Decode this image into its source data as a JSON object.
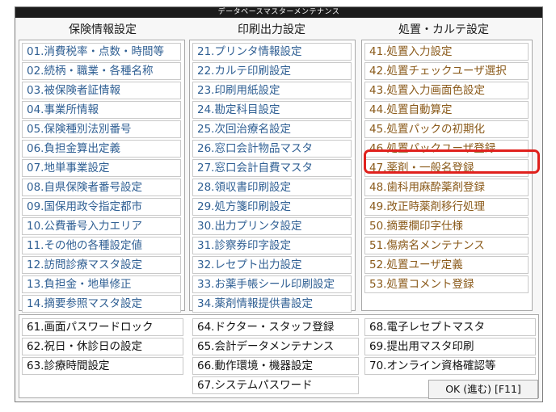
{
  "window": {
    "title": "データベースマスターメンテナンス"
  },
  "columns": [
    {
      "header": "保険情報設定",
      "items": [
        "01.消費税率・点数・時間等",
        "02.続柄・職業・各種名称",
        "03.被保険者証情報",
        "04.事業所情報",
        "05.保険種別法別番号",
        "06.負担金算出定義",
        "07.地単事業設定",
        "08.自県保険者番号設定",
        "09.国保用政令指定都市",
        "10.公費番号入力エリア",
        "11.その他の各種設定値",
        "12.訪問診療マスタ設定",
        "13.負担金・地単修正",
        "14.摘要参照マスタ設定"
      ]
    },
    {
      "header": "印刷出力設定",
      "items": [
        "21.プリンタ情報設定",
        "22.カルテ印刷設定",
        "23.印刷用紙設定",
        "24.勘定科目設定",
        "25.次回治療名設定",
        "26.窓口会計物品マスタ",
        "27.窓口会計自費マスタ",
        "28.領収書印刷設定",
        "29.処方箋印刷設定",
        "30.出力プリンタ設定",
        "31.診察券印字設定",
        "32.レセプト出力設定",
        "33.お薬手帳シール印刷設定",
        "34.薬剤情報提供書設定"
      ]
    },
    {
      "header": "処置・カルテ設定",
      "items": [
        "41.処置入力設定",
        "42.処置チェックユーザ選択",
        "43.処置入力画面色設定",
        "44.処置自動算定",
        "45.処置パックの初期化",
        "46.処置パックユーザ登録",
        "47.薬剤・一般名登録",
        "48.歯科用麻酔薬剤登録",
        "49.改正時薬剤移行処理",
        "50.摘要欄印字仕様",
        "51.傷病名メンテナンス",
        "52.処置ユーザ定義",
        "53.処置コメント登録"
      ]
    }
  ],
  "bottom": {
    "col1": [
      "61.画面パスワードロック",
      "62.祝日・休診日の設定",
      "63.診療時間設定"
    ],
    "col2": [
      "64.ドクター・スタッフ登録",
      "65.会計データメンテナンス",
      "66.動作環境・機器設定",
      "67.システムパスワード"
    ],
    "col3": [
      "68.電子レセプトマスタ",
      "69.提出用マスタ印刷",
      "70.オンライン資格確認等"
    ]
  },
  "ok_button": "OK (進む) [F11]",
  "colors": {
    "highlight": "#e0211d",
    "item_blue": "#2f5f93",
    "item_brown": "#8a5a1a"
  }
}
